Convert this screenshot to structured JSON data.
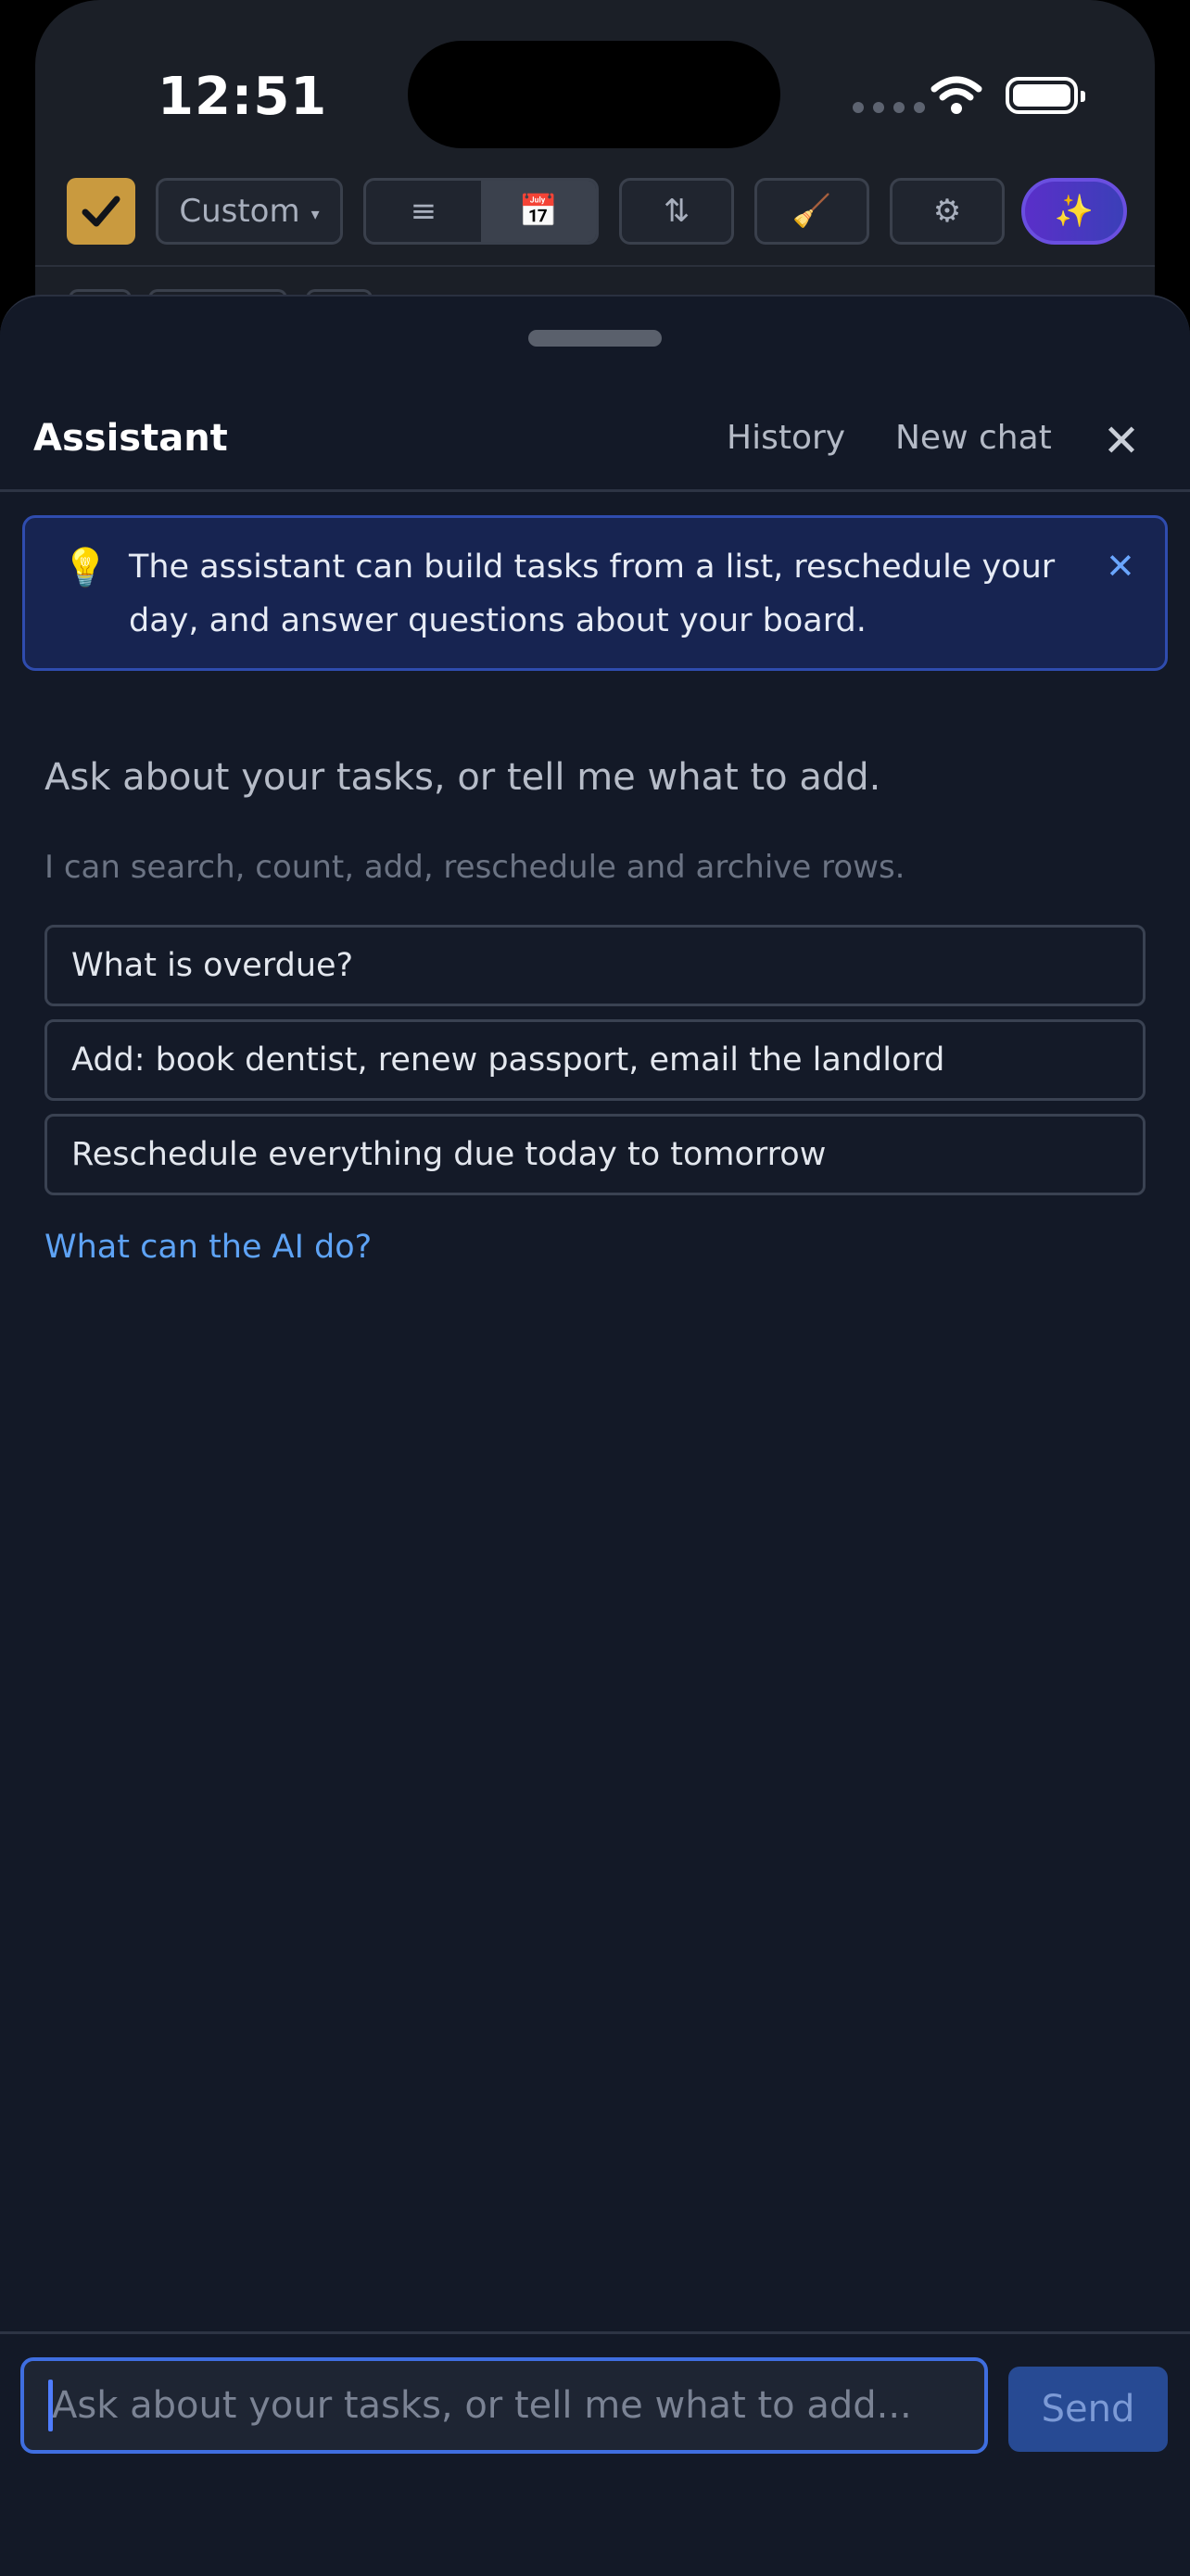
{
  "status_bar": {
    "time": "12:51"
  },
  "toolbar": {
    "filter_label": "Custom",
    "filter_caret": "▾",
    "list_view_icon": "≡",
    "calendar_view_icon": "📅",
    "sort_icon": "⇅",
    "sweep_icon": "🧹",
    "settings_icon": "⚙",
    "ai_icon": "✨"
  },
  "sheet": {
    "title": "Assistant",
    "history_label": "History",
    "new_chat_label": "New chat",
    "close_icon": "✕"
  },
  "tip": {
    "icon": "💡",
    "text": "The assistant can build tasks from a list, reschedule your day, and answer questions about your board.",
    "close_icon": "✕"
  },
  "empty_state": {
    "title": "Ask about your tasks, or tell me what to add.",
    "subtitle": "I can search, count, add, reschedule and archive rows.",
    "suggestions": [
      "What is overdue?",
      "Add: book dentist, renew passport, email the landlord",
      "Reschedule everything due today to tomorrow"
    ],
    "help_link": "What can the AI do?"
  },
  "composer": {
    "placeholder": "Ask about your tasks, or tell me what to add...",
    "value": "",
    "send_label": "Send"
  },
  "colors": {
    "sheet_bg": "#131927",
    "accent": "#3f6ee0",
    "link": "#5ea3f5",
    "tip_bg": "#172451"
  }
}
